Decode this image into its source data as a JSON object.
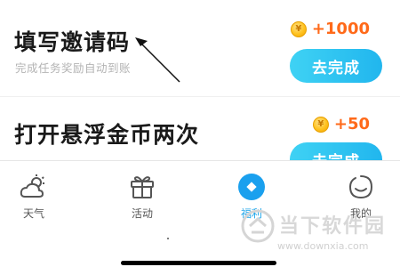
{
  "tasks": [
    {
      "title": "填写邀请码",
      "description": "完成任务奖励自动到账",
      "reward": "+1000",
      "action": "去完成"
    },
    {
      "title": "打开悬浮金币两次",
      "description": "",
      "reward": "+50",
      "action": "去完成"
    }
  ],
  "tabs": {
    "weather": "天气",
    "activity": "活动",
    "welfare": "福利",
    "me": "我的"
  },
  "watermark": {
    "name": "当下软件园",
    "url": "www.downxia.com"
  },
  "colors": {
    "accent": "#21b6ee",
    "reward": "#ff6a1a",
    "coin": "#ffc21f"
  }
}
